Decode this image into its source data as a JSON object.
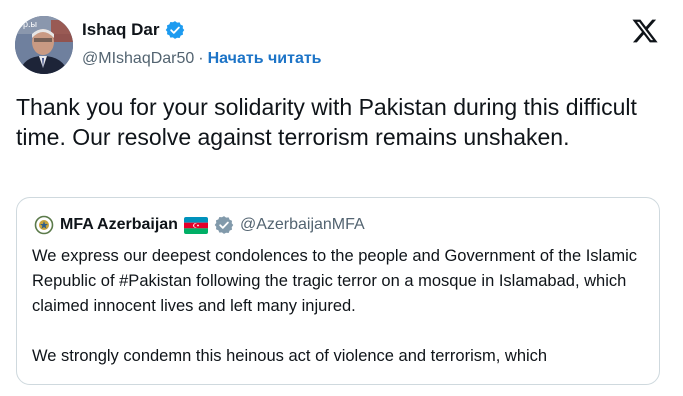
{
  "author": {
    "name": "Ishaq Dar",
    "handle": "@MIshaqDar50",
    "separator": "·",
    "follow_label": "Начать читать",
    "avatar_text": "ор.ы"
  },
  "tweet": {
    "text": "Thank you for your solidarity with Pakistan during this difficult time. Our resolve against terrorism remains unshaken."
  },
  "quote": {
    "name": "MFA Azerbaijan",
    "handle": "@AzerbaijanMFA",
    "paragraph_1": "We express our deepest condolences to the people and Government of the Islamic Republic of #Pakistan following the tragic terror on a mosque in Islamabad, which claimed innocent lives and left many injured.",
    "paragraph_2": "We strongly condemn this heinous act of violence and terrorism, which"
  },
  "icons": {
    "verified": "verified-badge-icon",
    "platform": "x-logo-icon",
    "flag": "azerbaijan-flag-icon",
    "government_badge": "government-badge-icon"
  },
  "colors": {
    "verified_blue": "#1d9bf0",
    "link_blue": "#1d74c7",
    "text": "#0f1419",
    "secondary": "#536471",
    "gov_gray": "#829aab"
  }
}
